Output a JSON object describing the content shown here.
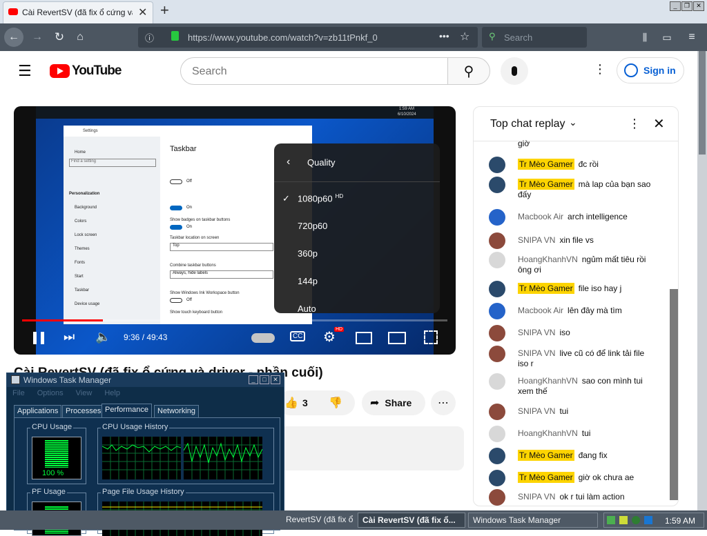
{
  "browser": {
    "tab_title": "Cài RevertSV (đã fix ổ cứng và dr...",
    "url": "https://www.youtube.com/watch?v=zb11tPnkf_0",
    "search_placeholder": "Search",
    "new_tab": "+"
  },
  "youtube": {
    "logo_text": "YouTube",
    "search_placeholder": "Search",
    "sign_in": "Sign in",
    "video_title": "Cài RevertSV (đã fix ổ cứng và driver - phần cuối)",
    "like_count": "3",
    "share_label": "Share"
  },
  "player": {
    "time": "9:36 / 49:43",
    "progress": 0.19,
    "quality_header": "Quality",
    "quality_options": [
      {
        "label": "1080p60",
        "badge": "HD",
        "selected": true
      },
      {
        "label": "720p60",
        "badge": "",
        "selected": false
      },
      {
        "label": "360p",
        "badge": "",
        "selected": false
      },
      {
        "label": "144p",
        "badge": "",
        "selected": false
      },
      {
        "label": "Auto",
        "badge": "",
        "selected": false
      }
    ],
    "hd_badge": "HD",
    "inner": {
      "settings_title": "Settings",
      "taskbar_heading": "Taskbar",
      "nav": [
        "Home",
        "Personalization",
        "Background",
        "Colors",
        "Lock screen",
        "Themes",
        "Fonts",
        "Start",
        "Taskbar",
        "Device usage"
      ],
      "find_setting": "Find a setting",
      "time": "1:59 AM",
      "date": "6/10/2024",
      "toggle_off": "Off",
      "toggle_on": "On",
      "taskbar_location_label": "Taskbar location on screen",
      "taskbar_location_value": "Top",
      "combine_label": "Combine taskbar buttons",
      "combine_value": "Always, hide labels",
      "show_badges": "Show badges on taskbar buttons",
      "ink_label": "Show Windows Ink Workspace button",
      "touch_label": "Show touch keyboard button"
    }
  },
  "chat": {
    "header": "Top chat replay",
    "top_fragment": "giờ",
    "messages": [
      {
        "author": "Tr Mèo Gamer",
        "mod": true,
        "text": "đc rồi",
        "av": "#2b4a6b"
      },
      {
        "author": "Tr Mèo Gamer",
        "mod": true,
        "text": "mà lap của bạn sao đấy",
        "av": "#2b4a6b"
      },
      {
        "author": "Macbook Air",
        "mod": false,
        "text": "arch intelligence",
        "av": "#2563c9"
      },
      {
        "author": "SNIPA VN",
        "mod": false,
        "text": "xin file vs",
        "av": "#8c4a3c"
      },
      {
        "author": "HoangKhanhVN",
        "mod": false,
        "text": "ngủm mất tiêu rồi ông ơi",
        "av": "#d8d8d8"
      },
      {
        "author": "Tr Mèo Gamer",
        "mod": true,
        "text": "file iso hay j",
        "av": "#2b4a6b"
      },
      {
        "author": "Macbook Air",
        "mod": false,
        "text": "lên đây mà tìm",
        "av": "#2563c9"
      },
      {
        "author": "SNIPA VN",
        "mod": false,
        "text": "iso",
        "av": "#8c4a3c"
      },
      {
        "author": "SNIPA VN",
        "mod": false,
        "text": "live cũ có để link tải file iso r",
        "av": "#8c4a3c"
      },
      {
        "author": "HoangKhanhVN",
        "mod": false,
        "text": "sao con mình tui xem thế",
        "av": "#d8d8d8"
      },
      {
        "author": "SNIPA VN",
        "mod": false,
        "text": "tui",
        "av": "#8c4a3c"
      },
      {
        "author": "HoangKhanhVN",
        "mod": false,
        "text": "tui",
        "av": "#d8d8d8"
      },
      {
        "author": "Tr Mèo Gamer",
        "mod": true,
        "text": "đang fix",
        "av": "#2b4a6b"
      },
      {
        "author": "Tr Mèo Gamer",
        "mod": true,
        "text": "giờ ok chưa ae",
        "av": "#2b4a6b"
      },
      {
        "author": "SNIPA VN",
        "mod": false,
        "text": "ok r tui làm action",
        "av": "#8c4a3c"
      }
    ]
  },
  "task_manager": {
    "title": "Windows Task Manager",
    "menu": [
      "File",
      "Options",
      "View",
      "Help"
    ],
    "tabs": [
      "Applications",
      "Processes",
      "Performance",
      "Networking"
    ],
    "active_tab": "Performance",
    "cpu_usage_label": "CPU Usage",
    "cpu_usage_value": "100 %",
    "cpu_usage_fraction": 1.0,
    "cpu_history_label": "CPU Usage History",
    "pf_usage_label": "PF Usage",
    "pf_history_label": "Page File Usage History"
  },
  "taskbar": {
    "items": [
      "RevertSV (đã fix ổ cứ...",
      "Cài RevertSV (đã fix ổ...",
      "Windows Task Manager"
    ],
    "clock": "1:59 AM"
  },
  "colors": {
    "yt_red": "#ff0000",
    "progress_red": "#ff0000",
    "mod_yellow": "#fdd400",
    "graph_green": "#00ff3c"
  }
}
